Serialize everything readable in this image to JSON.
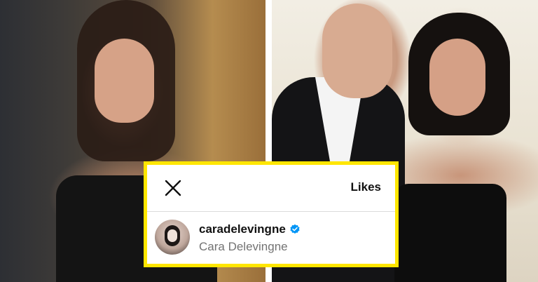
{
  "likes_card": {
    "title": "Likes",
    "close_icon": "close-icon",
    "accent_border": "#ffe600",
    "users": [
      {
        "username": "caradelevingne",
        "full_name": "Cara Delevingne",
        "verified": true,
        "verified_color": "#0095f6"
      }
    ]
  },
  "photos": [
    {
      "name": "left-photo"
    },
    {
      "name": "right-photo"
    }
  ]
}
